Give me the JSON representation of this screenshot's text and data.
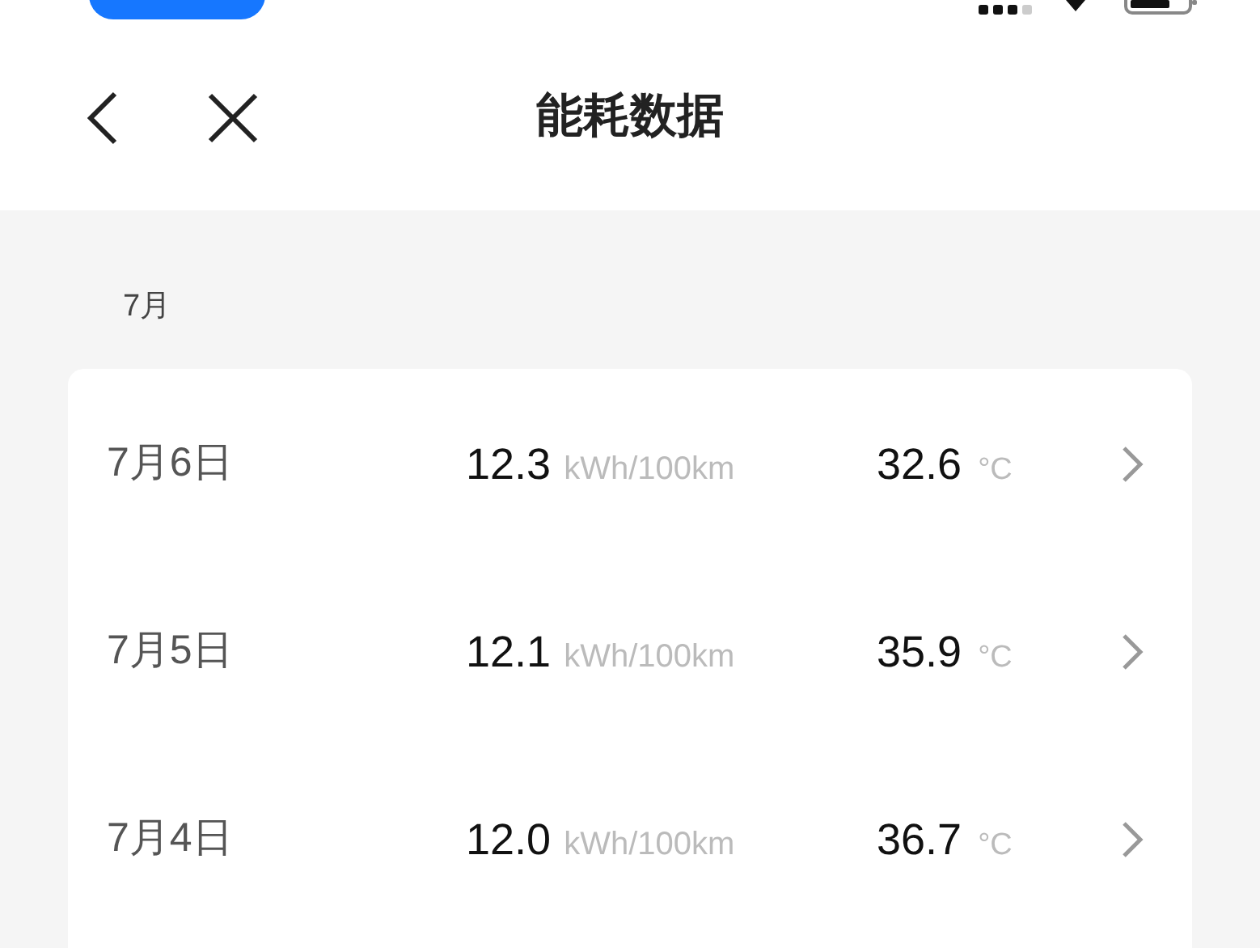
{
  "nav": {
    "title": "能耗数据"
  },
  "section": {
    "label": "7月"
  },
  "rows": [
    {
      "date": "7月6日",
      "consumption": "12.3",
      "consumption_unit": "kWh/100km",
      "temperature": "32.6",
      "temperature_unit": "°C"
    },
    {
      "date": "7月5日",
      "consumption": "12.1",
      "consumption_unit": "kWh/100km",
      "temperature": "35.9",
      "temperature_unit": "°C"
    },
    {
      "date": "7月4日",
      "consumption": "12.0",
      "consumption_unit": "kWh/100km",
      "temperature": "36.7",
      "temperature_unit": "°C"
    }
  ]
}
